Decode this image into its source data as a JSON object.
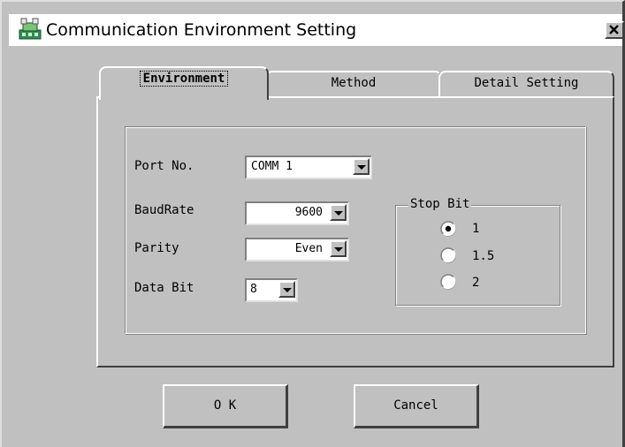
{
  "window": {
    "title": "Communication Environment Setting",
    "icon": "network-icon",
    "close_symbol": "✕"
  },
  "tabs": [
    {
      "label": "Environment",
      "active": true
    },
    {
      "label": "Method",
      "active": false
    },
    {
      "label": "Detail Setting",
      "active": false
    }
  ],
  "fields": {
    "port": {
      "label": "Port No.",
      "value": "COMM 1"
    },
    "baud": {
      "label": "BaudRate",
      "value": "9600"
    },
    "parity": {
      "label": "Parity",
      "value": "Even"
    },
    "databit": {
      "label": "Data Bit",
      "value": "8"
    }
  },
  "stop_bit": {
    "legend": "Stop Bit",
    "options": [
      {
        "label": "1",
        "selected": true
      },
      {
        "label": "1.5",
        "selected": false
      },
      {
        "label": "2",
        "selected": false
      }
    ]
  },
  "buttons": {
    "ok": "O K",
    "cancel": "Cancel"
  }
}
